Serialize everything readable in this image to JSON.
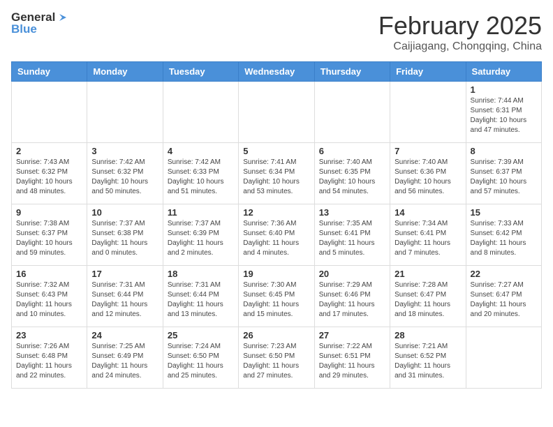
{
  "header": {
    "logo_general": "General",
    "logo_blue": "Blue",
    "title": "February 2025",
    "location": "Caijiagang, Chongqing, China"
  },
  "weekdays": [
    "Sunday",
    "Monday",
    "Tuesday",
    "Wednesday",
    "Thursday",
    "Friday",
    "Saturday"
  ],
  "weeks": [
    [
      {
        "day": null
      },
      {
        "day": null
      },
      {
        "day": null
      },
      {
        "day": null
      },
      {
        "day": null
      },
      {
        "day": null
      },
      {
        "day": 1,
        "sunrise": "7:44 AM",
        "sunset": "6:31 PM",
        "daylight": "10 hours and 47 minutes."
      }
    ],
    [
      {
        "day": 2,
        "sunrise": "7:43 AM",
        "sunset": "6:32 PM",
        "daylight": "10 hours and 48 minutes."
      },
      {
        "day": 3,
        "sunrise": "7:42 AM",
        "sunset": "6:32 PM",
        "daylight": "10 hours and 50 minutes."
      },
      {
        "day": 4,
        "sunrise": "7:42 AM",
        "sunset": "6:33 PM",
        "daylight": "10 hours and 51 minutes."
      },
      {
        "day": 5,
        "sunrise": "7:41 AM",
        "sunset": "6:34 PM",
        "daylight": "10 hours and 53 minutes."
      },
      {
        "day": 6,
        "sunrise": "7:40 AM",
        "sunset": "6:35 PM",
        "daylight": "10 hours and 54 minutes."
      },
      {
        "day": 7,
        "sunrise": "7:40 AM",
        "sunset": "6:36 PM",
        "daylight": "10 hours and 56 minutes."
      },
      {
        "day": 8,
        "sunrise": "7:39 AM",
        "sunset": "6:37 PM",
        "daylight": "10 hours and 57 minutes."
      }
    ],
    [
      {
        "day": 9,
        "sunrise": "7:38 AM",
        "sunset": "6:37 PM",
        "daylight": "10 hours and 59 minutes."
      },
      {
        "day": 10,
        "sunrise": "7:37 AM",
        "sunset": "6:38 PM",
        "daylight": "11 hours and 0 minutes."
      },
      {
        "day": 11,
        "sunrise": "7:37 AM",
        "sunset": "6:39 PM",
        "daylight": "11 hours and 2 minutes."
      },
      {
        "day": 12,
        "sunrise": "7:36 AM",
        "sunset": "6:40 PM",
        "daylight": "11 hours and 4 minutes."
      },
      {
        "day": 13,
        "sunrise": "7:35 AM",
        "sunset": "6:41 PM",
        "daylight": "11 hours and 5 minutes."
      },
      {
        "day": 14,
        "sunrise": "7:34 AM",
        "sunset": "6:41 PM",
        "daylight": "11 hours and 7 minutes."
      },
      {
        "day": 15,
        "sunrise": "7:33 AM",
        "sunset": "6:42 PM",
        "daylight": "11 hours and 8 minutes."
      }
    ],
    [
      {
        "day": 16,
        "sunrise": "7:32 AM",
        "sunset": "6:43 PM",
        "daylight": "11 hours and 10 minutes."
      },
      {
        "day": 17,
        "sunrise": "7:31 AM",
        "sunset": "6:44 PM",
        "daylight": "11 hours and 12 minutes."
      },
      {
        "day": 18,
        "sunrise": "7:31 AM",
        "sunset": "6:44 PM",
        "daylight": "11 hours and 13 minutes."
      },
      {
        "day": 19,
        "sunrise": "7:30 AM",
        "sunset": "6:45 PM",
        "daylight": "11 hours and 15 minutes."
      },
      {
        "day": 20,
        "sunrise": "7:29 AM",
        "sunset": "6:46 PM",
        "daylight": "11 hours and 17 minutes."
      },
      {
        "day": 21,
        "sunrise": "7:28 AM",
        "sunset": "6:47 PM",
        "daylight": "11 hours and 18 minutes."
      },
      {
        "day": 22,
        "sunrise": "7:27 AM",
        "sunset": "6:47 PM",
        "daylight": "11 hours and 20 minutes."
      }
    ],
    [
      {
        "day": 23,
        "sunrise": "7:26 AM",
        "sunset": "6:48 PM",
        "daylight": "11 hours and 22 minutes."
      },
      {
        "day": 24,
        "sunrise": "7:25 AM",
        "sunset": "6:49 PM",
        "daylight": "11 hours and 24 minutes."
      },
      {
        "day": 25,
        "sunrise": "7:24 AM",
        "sunset": "6:50 PM",
        "daylight": "11 hours and 25 minutes."
      },
      {
        "day": 26,
        "sunrise": "7:23 AM",
        "sunset": "6:50 PM",
        "daylight": "11 hours and 27 minutes."
      },
      {
        "day": 27,
        "sunrise": "7:22 AM",
        "sunset": "6:51 PM",
        "daylight": "11 hours and 29 minutes."
      },
      {
        "day": 28,
        "sunrise": "7:21 AM",
        "sunset": "6:52 PM",
        "daylight": "11 hours and 31 minutes."
      },
      {
        "day": null
      }
    ]
  ],
  "labels": {
    "sunrise": "Sunrise:",
    "sunset": "Sunset:",
    "daylight": "Daylight:"
  }
}
